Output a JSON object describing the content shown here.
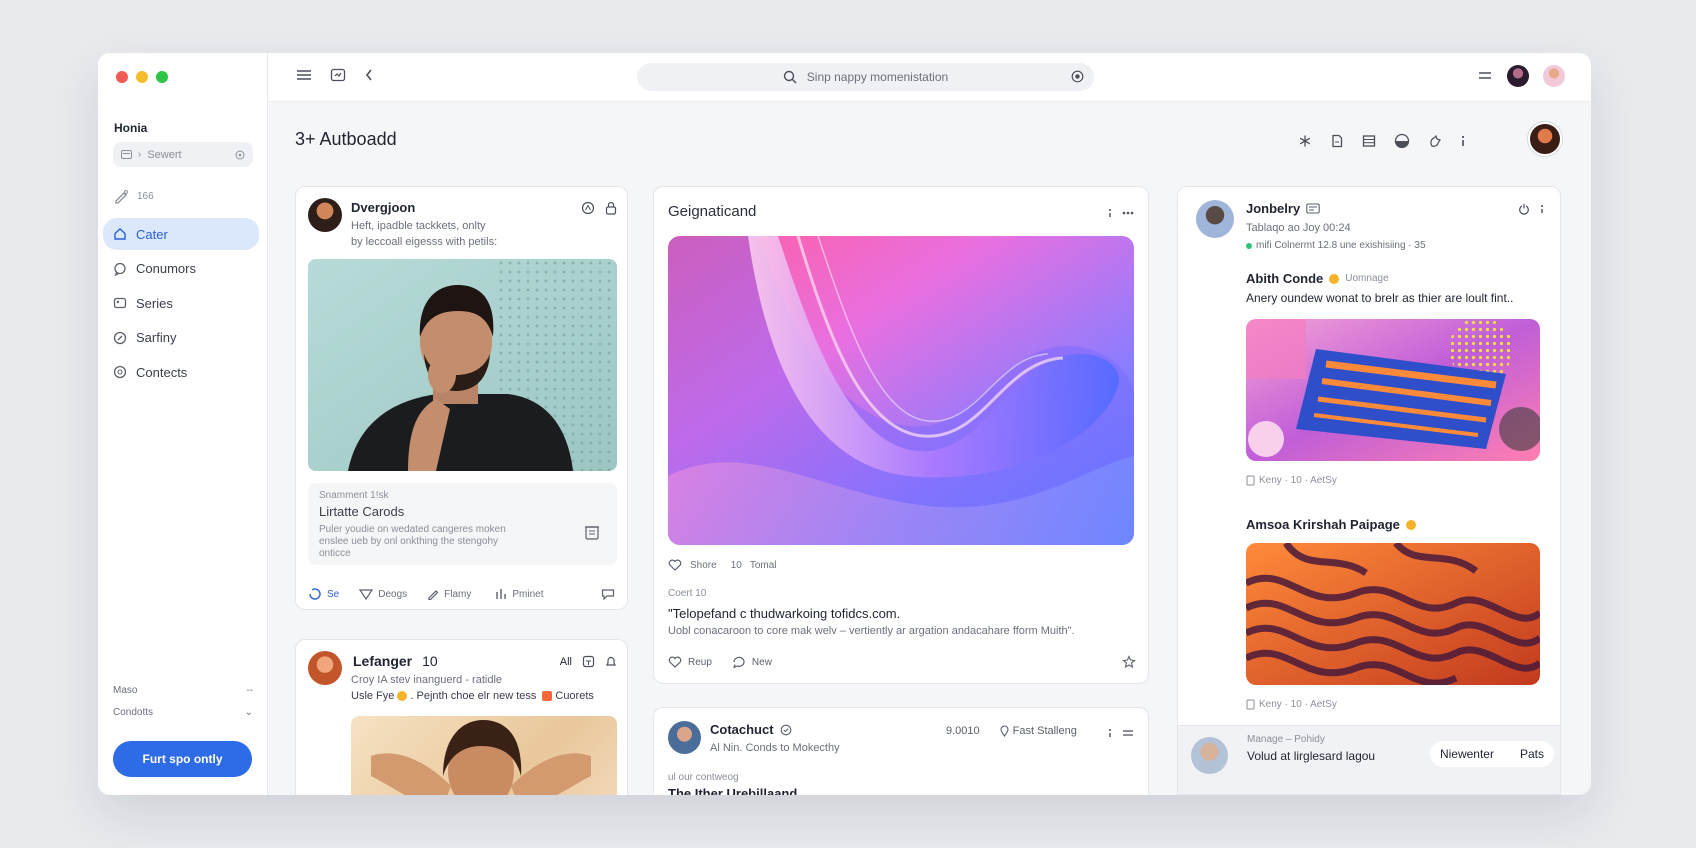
{
  "window": {
    "traffic_colors": [
      "#f05b55",
      "#f4bd2e",
      "#2ec445"
    ]
  },
  "sidebar": {
    "home_label": "Honia",
    "search_placeholder": "Sewert",
    "misc_label": "166",
    "nav": [
      {
        "label": "Cater",
        "icon": "home-icon",
        "active": true
      },
      {
        "label": "Conumors",
        "icon": "chat-icon",
        "active": false
      },
      {
        "label": "Series",
        "icon": "gallery-icon",
        "active": false
      },
      {
        "label": "Sarfiny",
        "icon": "pin-icon",
        "active": false
      },
      {
        "label": "Contects",
        "icon": "info-icon",
        "active": false
      }
    ],
    "footer": [
      {
        "label": "Maso",
        "value": "--"
      },
      {
        "label": "Condotts",
        "value": "⌄"
      }
    ],
    "cta_label": "Furt spo ontly"
  },
  "topbar": {
    "search_placeholder": "Sinp nappy momenistation"
  },
  "page": {
    "title": "3+ Autboadd"
  },
  "card1": {
    "author": "Dvergjoon",
    "line1": "Heft, ipadble tackkets, onlty",
    "line2": "by leccoall eigesss with petils:",
    "inner_kicker": "Snamment 1!sk",
    "inner_title": "Lirtatte Carods",
    "inner_body": "Puler youdie on wedated cangeres moken\nenslee ueb by onl onkthing the stengohy\nonticce",
    "actions": [
      "Se",
      "Deogs",
      "Flamy",
      "Pminet"
    ]
  },
  "card2": {
    "author": "Lefanger",
    "count": "10",
    "tag": "All",
    "line1": "Croy IA stev inanguerd - ratidle",
    "line2_a": "Usle Fye",
    "line2_b": ". Pejnth choe elr new tess",
    "line2_c": "Cuorets"
  },
  "card3": {
    "title": "Geignaticand",
    "stats": [
      "Shore",
      "10",
      "Tomal"
    ],
    "kicker": "Coert 10",
    "headline": "\"Telopefand c thudwarkoing tofidcs.com.",
    "body": "Uobl conacaroon to core mak welv – vertiently ar argation andacahare fform Muith\".",
    "actions": [
      "Reup",
      "New"
    ]
  },
  "card4": {
    "author": "Cotachuct",
    "sub": "Al Nin. Conds to Mokecthy",
    "meta_num": "9.0010",
    "meta_loc": "Fast Stalleng",
    "kicker": "ul our contweog",
    "headline": "The Ither Urebillaand"
  },
  "card5": {
    "author": "Jonbelry",
    "date": "Tablaqo ao Joy 00:24",
    "status": "mifi Colnermt 12.8 une exishisiing · 35",
    "post1_title": "Abith Conde",
    "post1_badge": "Uomnage",
    "post1_text": "Anery oundew wonat to brelr as thier are loult fint..",
    "post1_meta": "Keny · 10 · AetSy",
    "post2_title": "Amsoa Krirshah Paipage",
    "post2_meta": "Keny · 10 · AetSy",
    "footer_kicker": "Manage – Pohidy",
    "footer_text": "Volud at lirglesard lagou",
    "footer_btn1": "Niewenter",
    "footer_btn2": "Pats"
  }
}
